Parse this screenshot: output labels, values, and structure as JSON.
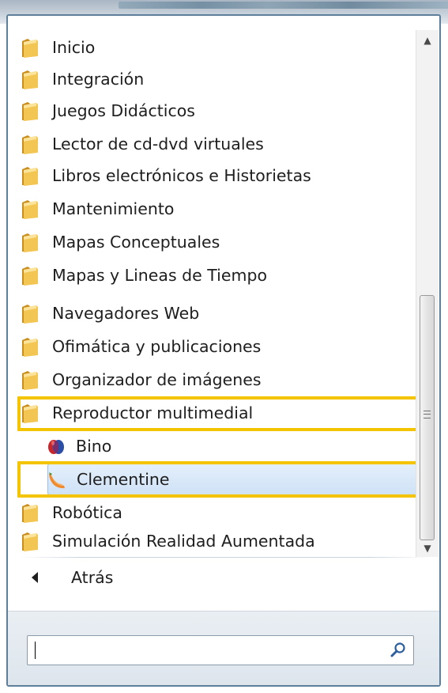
{
  "menu": {
    "folders_top": [
      "Inicio",
      "Integración",
      "Juegos Didácticos",
      "Lector de cd-dvd virtuales",
      "Libros electrónicos e Historietas",
      "Mantenimiento",
      "Mapas Conceptuales",
      "Mapas y Lineas de Tiempo",
      "Navegadores Web",
      "Ofimática y publicaciones",
      "Organizador de imágenes",
      "Reproductor multimedial"
    ],
    "children": [
      {
        "label": "Bino",
        "icon": "bino-app-icon"
      },
      {
        "label": "Clementine",
        "icon": "clementine-app-icon",
        "selected": true
      }
    ],
    "folders_bottom": [
      "Robótica",
      "Simulación Realidad Aumentada"
    ]
  },
  "back": {
    "label": "Atrás"
  },
  "search": {
    "value": "",
    "placeholder": ""
  },
  "colors": {
    "highlight": "#f5c400",
    "selection": "#cfe2f7",
    "folder": "#e8b23c",
    "frame": "#5d7f9a"
  }
}
